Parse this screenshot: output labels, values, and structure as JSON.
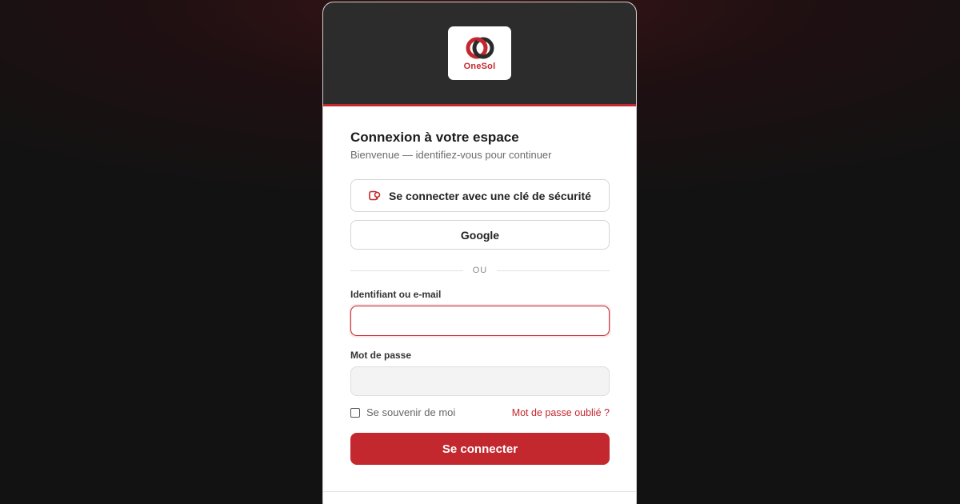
{
  "brand": {
    "name": "OneSol",
    "logo_icon": "onesol-rings-logo",
    "accent_color": "#c3282f",
    "header_color": "#2c2c2c"
  },
  "login": {
    "title": "Connexion à votre espace",
    "subtitle": "Bienvenue — identifiez-vous pour continuer",
    "security_key_button": {
      "label": "Se connecter avec une clé de sécurité",
      "icon": "security-key-icon"
    },
    "google_button": {
      "label": "Google"
    },
    "divider_label": "OU",
    "username": {
      "label": "Identifiant ou e-mail",
      "value": "",
      "placeholder": ""
    },
    "password": {
      "label": "Mot de passe",
      "value": "",
      "placeholder": ""
    },
    "remember_me": {
      "label": "Se souvenir de moi",
      "checked": false
    },
    "forgot_password": "Mot de passe oublié ?",
    "submit_label": "Se connecter"
  }
}
